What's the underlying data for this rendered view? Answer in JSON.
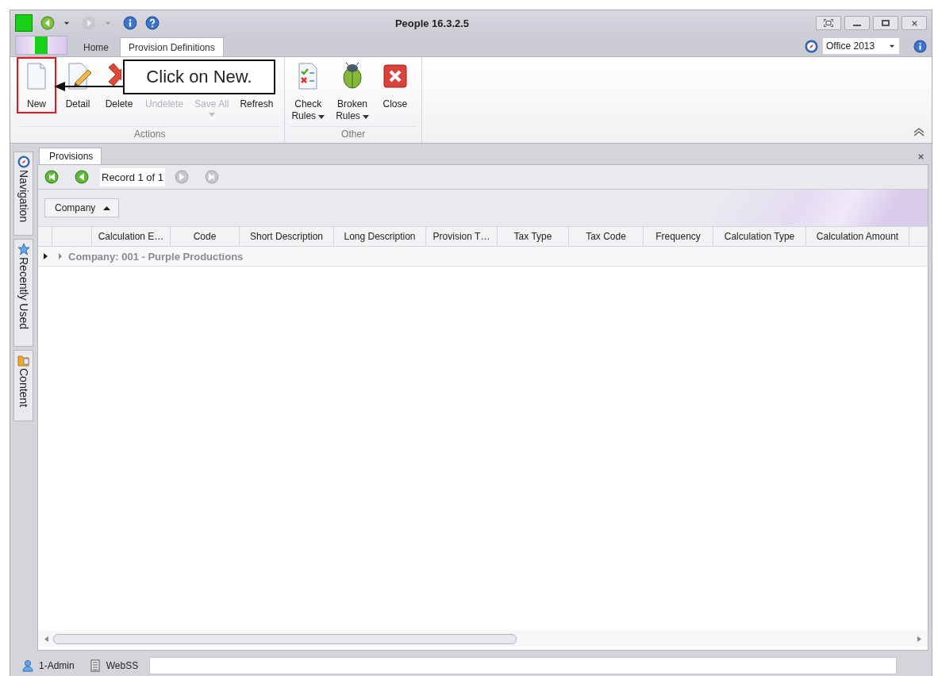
{
  "window": {
    "title": "People 16.3.2.5"
  },
  "quick_access": [
    {
      "disabled": false,
      "dropdown": true
    },
    {
      "disabled": true,
      "dropdown": true
    },
    {
      "disabled": false,
      "dropdown": false
    },
    {
      "disabled": false,
      "dropdown": false
    }
  ],
  "ribbon_tabs": [
    {
      "label": "Home",
      "selected": false
    },
    {
      "label": "Provision Definitions",
      "selected": true
    }
  ],
  "theme_dropdown": {
    "value": "Office 2013"
  },
  "ribbon_groups": [
    {
      "label": "Actions",
      "buttons": [
        {
          "label": "New",
          "disabled": false,
          "dropdown": false,
          "highlighted": true
        },
        {
          "label": "Detail",
          "disabled": false,
          "dropdown": false,
          "highlighted": false
        },
        {
          "label": "Delete",
          "disabled": false,
          "dropdown": false,
          "highlighted": false
        },
        {
          "label": "Undelete",
          "disabled": true,
          "dropdown": false,
          "highlighted": false
        },
        {
          "label": "Save All",
          "disabled": true,
          "dropdown": true,
          "highlighted": false
        },
        {
          "label": "Refresh",
          "disabled": false,
          "dropdown": false,
          "highlighted": false
        }
      ]
    },
    {
      "label": "Other",
      "buttons": [
        {
          "label": "Check\nRules",
          "disabled": false,
          "dropdown": true,
          "highlighted": false
        },
        {
          "label": "Broken\nRules",
          "disabled": false,
          "dropdown": true,
          "highlighted": false
        },
        {
          "label": "Close",
          "disabled": false,
          "dropdown": false,
          "highlighted": false
        }
      ]
    }
  ],
  "callout": {
    "text": "Click on New."
  },
  "dock_tabs": [
    {
      "label": "Navigation"
    },
    {
      "label": "Recently Used"
    },
    {
      "label": "Content"
    }
  ],
  "document_tab": {
    "label": "Provisions"
  },
  "record_navigator": {
    "text": "Record 1 of 1",
    "buttons_before": [
      {
        "disabled": false
      },
      {
        "disabled": false
      }
    ],
    "buttons_after": [
      {
        "disabled": true
      },
      {
        "disabled": true
      }
    ]
  },
  "group_panel": {
    "label": "Company",
    "sort_ascending": true
  },
  "grid": {
    "columns": [
      {
        "label": "Calculation E…"
      },
      {
        "label": "Code"
      },
      {
        "label": "Short Description"
      },
      {
        "label": "Long Description"
      },
      {
        "label": "Provision T…"
      },
      {
        "label": "Tax Type"
      },
      {
        "label": "Tax Code"
      },
      {
        "label": "Frequency"
      },
      {
        "label": "Calculation Type"
      },
      {
        "label": "Calculation Amount"
      }
    ],
    "group_rows": [
      {
        "label": "Company: 001 - Purple Productions",
        "expanded": false,
        "current": true
      }
    ]
  },
  "status_bar": {
    "user": "1-Admin",
    "server": "WebSS"
  }
}
